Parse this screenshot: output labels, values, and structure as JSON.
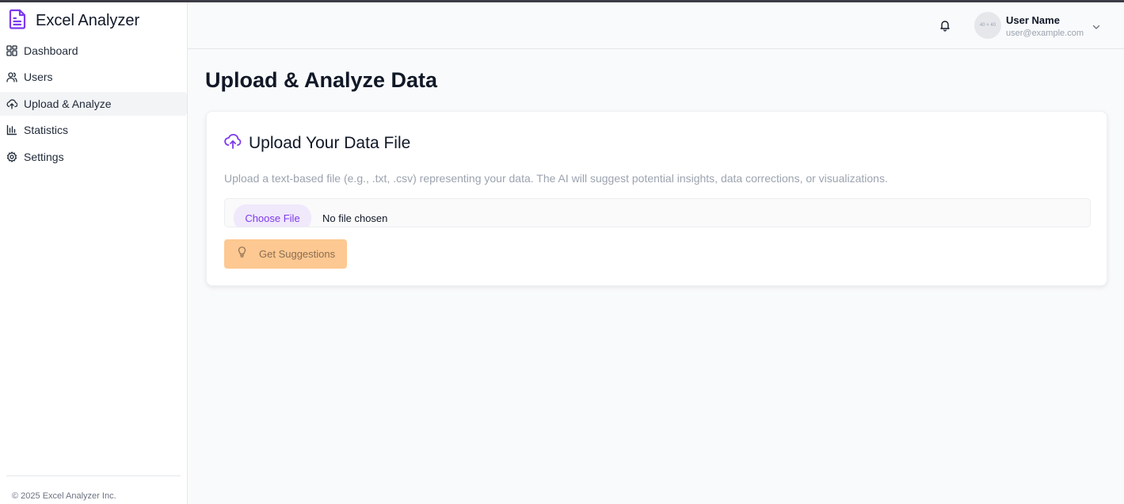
{
  "app": {
    "title": "Excel Analyzer",
    "brand_color": "#7c3aed"
  },
  "sidebar": {
    "items": [
      {
        "label": "Dashboard",
        "icon": "dashboard-grid-icon",
        "active": false
      },
      {
        "label": "Users",
        "icon": "users-icon",
        "active": false
      },
      {
        "label": "Upload & Analyze",
        "icon": "cloud-upload-icon",
        "active": true
      },
      {
        "label": "Statistics",
        "icon": "bar-chart-icon",
        "active": false
      },
      {
        "label": "Settings",
        "icon": "gear-icon",
        "active": false
      }
    ],
    "footer": "© 2025 Excel Analyzer Inc."
  },
  "header": {
    "avatar_placeholder": "40 × 40",
    "user_name": "User Name",
    "user_email": "user@example.com"
  },
  "main": {
    "page_title": "Upload & Analyze Data",
    "card": {
      "title": "Upload Your Data File",
      "description": "Upload a text-based file (e.g., .txt, .csv) representing your data. The AI will suggest potential insights, data corrections, or visualizations.",
      "choose_file_label": "Choose File",
      "file_status": "No file chosen",
      "suggest_button_label": "Get Suggestions",
      "suggest_button_color": "#fdc891"
    }
  }
}
